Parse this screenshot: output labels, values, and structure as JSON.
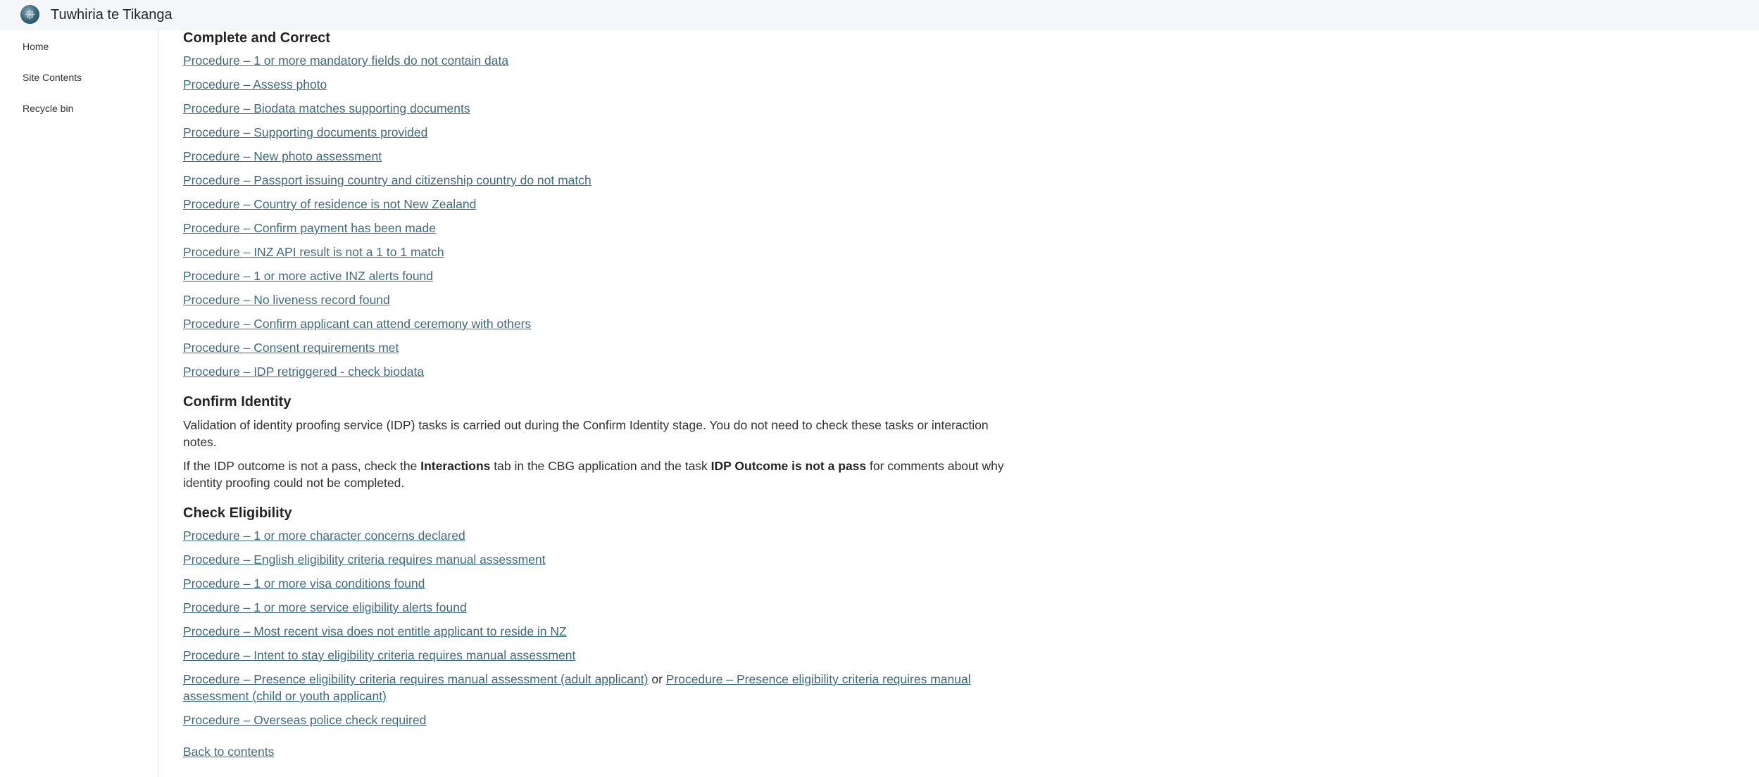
{
  "header": {
    "site_title": "Tuwhiria te Tikanga",
    "logo_icon": "site-logo-icon"
  },
  "sidebar": {
    "items": [
      {
        "label": "Home"
      },
      {
        "label": "Site Contents"
      },
      {
        "label": "Recycle bin"
      }
    ]
  },
  "sections": {
    "complete": {
      "heading": "Complete and Correct",
      "links": [
        "Procedure – 1 or more mandatory fields do not contain data",
        "Procedure – Assess photo",
        "Procedure – Biodata matches supporting documents",
        "Procedure – Supporting documents provided",
        "Procedure – New photo assessment",
        "Procedure – Passport issuing country and citizenship country do not match",
        "Procedure – Country of residence is not New Zealand",
        "Procedure – Confirm payment has been made",
        "Procedure – INZ API result is not a 1 to 1 match",
        "Procedure – 1 or more active INZ alerts found",
        "Procedure – No liveness record found",
        "Procedure – Confirm applicant can attend ceremony with others",
        "Procedure – Consent requirements met",
        "Procedure – IDP retriggered - check biodata"
      ]
    },
    "identity": {
      "heading": "Confirm Identity",
      "para1": "Validation of identity proofing service (IDP) tasks is carried out during the Confirm Identity stage. You do not need to check these tasks or interaction notes.",
      "para2_a": "If the IDP outcome is not a pass, check the ",
      "para2_b": "Interactions",
      "para2_c": " tab in the CBG application and the task ",
      "para2_d": "IDP Outcome is not a pass",
      "para2_e": " for comments about why identity proofing could not be completed."
    },
    "eligibility": {
      "heading": "Check Eligibility",
      "links": [
        "Procedure – 1 or more character concerns declared",
        "Procedure – English eligibility criteria requires manual assessment",
        "Procedure – 1 or more visa conditions found",
        "Procedure – 1 or more service eligibility alerts found",
        "Procedure – Most recent visa does not entitle applicant to reside in NZ",
        "Procedure – Intent to stay eligibility criteria requires manual assessment"
      ],
      "presence_adult": "Procedure – Presence eligibility criteria requires manual assessment (adult applicant)",
      "presence_or": " or ",
      "presence_child": "Procedure – Presence eligibility criteria requires manual assessment (child or youth applicant)",
      "overseas": "Procedure – Overseas police check required"
    }
  },
  "footer": {
    "back_link": "Back to contents"
  },
  "colors": {
    "link": "#3d6c80",
    "topbar": "#f4f6f9",
    "text": "#323130"
  }
}
